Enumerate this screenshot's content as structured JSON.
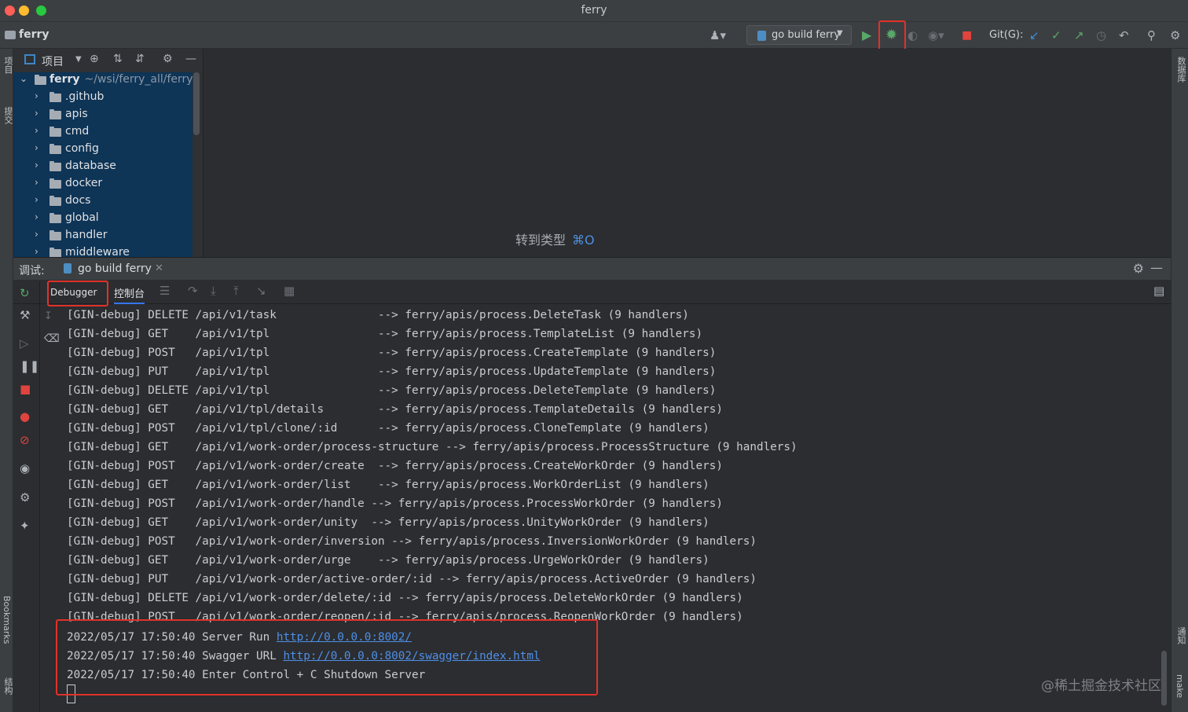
{
  "window": {
    "title": "ferry"
  },
  "toolbar": {
    "project_name": "ferry",
    "run_config": "go build ferry",
    "git_label": "Git(G):",
    "icons": [
      "user-icon",
      "run-icon",
      "debug-icon",
      "coverage-icon",
      "profile-icon",
      "stop-icon",
      "git-update-icon",
      "git-commit-icon",
      "git-push-icon",
      "history-icon",
      "rollback-icon",
      "search-icon",
      "settings-icon"
    ]
  },
  "left_strip": {
    "project_tab": "项目",
    "commit_tab": "提交",
    "bookmarks_tab": "Bookmarks",
    "structure_tab": "结构"
  },
  "right_strip": {
    "database_tab": "数据库",
    "notifications_tab": "通知",
    "make_tab": "make"
  },
  "project_panel": {
    "view_label": "项目",
    "root": {
      "name": "ferry",
      "path": "~/wsi/ferry_all/ferry"
    },
    "items": [
      ".github",
      "apis",
      "cmd",
      "config",
      "database",
      "docker",
      "docs",
      "global",
      "handler",
      "middleware"
    ]
  },
  "editor": {
    "hint_text": "转到类型",
    "hint_shortcut": "⌘O"
  },
  "debug": {
    "title": "调试:",
    "session_tab": "go build ferry",
    "subtabs": {
      "debugger": "Debugger",
      "console": "控制台"
    }
  },
  "console": {
    "lines": [
      "[GIN-debug] DELETE /api/v1/task               --> ferry/apis/process.DeleteTask (9 handlers)",
      "[GIN-debug] GET    /api/v1/tpl                --> ferry/apis/process.TemplateList (9 handlers)",
      "[GIN-debug] POST   /api/v1/tpl                --> ferry/apis/process.CreateTemplate (9 handlers)",
      "[GIN-debug] PUT    /api/v1/tpl                --> ferry/apis/process.UpdateTemplate (9 handlers)",
      "[GIN-debug] DELETE /api/v1/tpl                --> ferry/apis/process.DeleteTemplate (9 handlers)",
      "[GIN-debug] GET    /api/v1/tpl/details        --> ferry/apis/process.TemplateDetails (9 handlers)",
      "[GIN-debug] POST   /api/v1/tpl/clone/:id      --> ferry/apis/process.CloneTemplate (9 handlers)",
      "[GIN-debug] GET    /api/v1/work-order/process-structure --> ferry/apis/process.ProcessStructure (9 handlers)",
      "[GIN-debug] POST   /api/v1/work-order/create  --> ferry/apis/process.CreateWorkOrder (9 handlers)",
      "[GIN-debug] GET    /api/v1/work-order/list    --> ferry/apis/process.WorkOrderList (9 handlers)",
      "[GIN-debug] POST   /api/v1/work-order/handle --> ferry/apis/process.ProcessWorkOrder (9 handlers)",
      "[GIN-debug] GET    /api/v1/work-order/unity  --> ferry/apis/process.UnityWorkOrder (9 handlers)",
      "[GIN-debug] POST   /api/v1/work-order/inversion --> ferry/apis/process.InversionWorkOrder (9 handlers)",
      "[GIN-debug] GET    /api/v1/work-order/urge    --> ferry/apis/process.UrgeWorkOrder (9 handlers)",
      "[GIN-debug] PUT    /api/v1/work-order/active-order/:id --> ferry/apis/process.ActiveOrder (9 handlers)",
      "[GIN-debug] DELETE /api/v1/work-order/delete/:id --> ferry/apis/process.DeleteWorkOrder (9 handlers)",
      "[GIN-debug] POST   /api/v1/work-order/reopen/:id --> ferry/apis/process.ReopenWorkOrder (9 handlers)"
    ],
    "server_run_prefix": "2022/05/17 17:50:40 Server Run ",
    "server_run_url": "http://0.0.0.0:8002/",
    "swagger_prefix": "2022/05/17 17:50:40 Swagger URL ",
    "swagger_url": "http://0.0.0.0:8002/swagger/index.html",
    "shutdown_line": "2022/05/17 17:50:40 Enter Control + C Shutdown Server"
  },
  "watermark": "@稀土掘金技术社区",
  "colors": {
    "accent": "#3574f0",
    "highlight_box": "#e0322a",
    "link": "#4f8fe8",
    "tree_selection": "#0e3456"
  }
}
